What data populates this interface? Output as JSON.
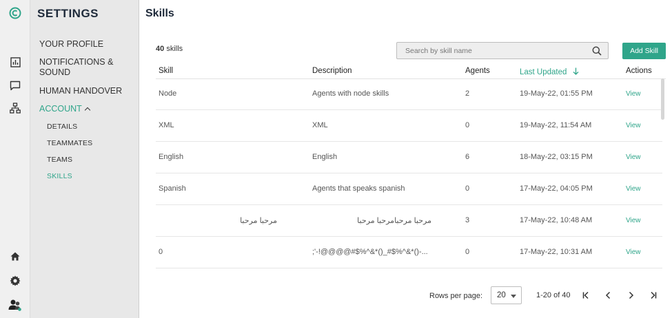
{
  "rail": {
    "icons": [
      "logo-icon",
      "analytics-icon",
      "chat-icon",
      "org-chart-icon",
      "home-icon",
      "gear-icon",
      "user-avatar-icon"
    ]
  },
  "sidebar": {
    "title": "SETTINGS",
    "items": [
      {
        "label": "YOUR PROFILE"
      },
      {
        "label": "NOTIFICATIONS & SOUND"
      },
      {
        "label": "HUMAN HANDOVER"
      },
      {
        "label": "ACCOUNT"
      }
    ],
    "sub_items": [
      {
        "label": "DETAILS"
      },
      {
        "label": "TEAMMATES"
      },
      {
        "label": "TEAMS"
      },
      {
        "label": "SKILLS"
      }
    ]
  },
  "main": {
    "title": "Skills",
    "count_number": "40",
    "count_label": "skills",
    "search_placeholder": "Search by skill name",
    "add_button": "Add Skill",
    "columns": {
      "skill": "Skill",
      "description": "Description",
      "agents": "Agents",
      "last_updated": "Last Updated",
      "actions": "Actions"
    },
    "rows": [
      {
        "skill": "Node",
        "description": "Agents with node skills",
        "agents": "2",
        "updated": "19-May-22, 01:55 PM",
        "action": "View"
      },
      {
        "skill": "XML",
        "description": "XML",
        "agents": "0",
        "updated": "19-May-22, 11:54 AM",
        "action": "View"
      },
      {
        "skill": "English",
        "description": "English",
        "agents": "6",
        "updated": "18-May-22, 03:15 PM",
        "action": "View"
      },
      {
        "skill": "Spanish",
        "description": "Agents that speaks spanish",
        "agents": "0",
        "updated": "17-May-22, 04:05 PM",
        "action": "View"
      },
      {
        "skill": "مرحبا مرحبا",
        "description": "مرحبا مرحبامرحبا مرحبا",
        "agents": "3",
        "updated": "17-May-22, 10:48 AM",
        "action": "View"
      },
      {
        "skill": "0",
        "description": ";'-!@@@@#$%^&*()_#$%^&*()-...",
        "agents": "0",
        "updated": "17-May-22, 10:31 AM",
        "action": "View"
      }
    ]
  },
  "pagination": {
    "rows_per_page_label": "Rows per page:",
    "rows_per_page_value": "20",
    "range": "1-20 of 40"
  },
  "colors": {
    "accent": "#2fa58a",
    "sidebar_bg": "#e8e8e8",
    "rail_bg": "#f0f0f0"
  }
}
